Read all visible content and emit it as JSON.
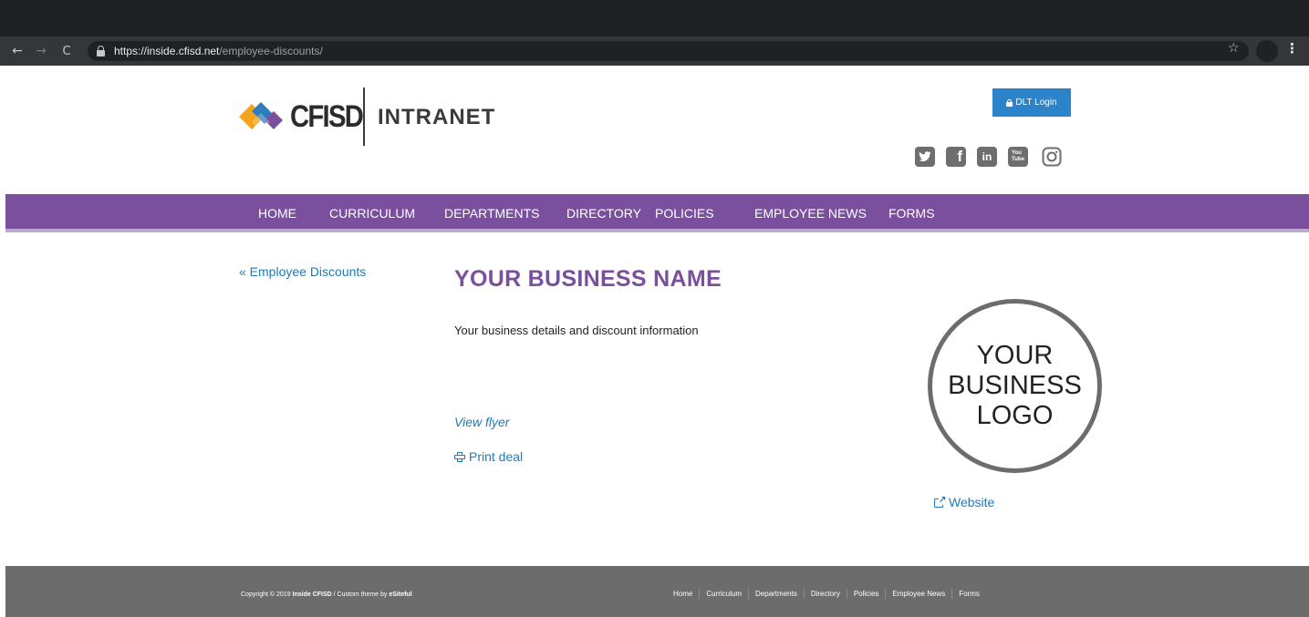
{
  "browser": {
    "url_host": "https://inside.cfisd.net",
    "url_path": "/employee-discounts/",
    "icons": {
      "back": "←",
      "forward": "→",
      "reload": "C",
      "star": "☆",
      "menu": "⋮"
    }
  },
  "header": {
    "logo_text": "CFISD",
    "logo_sub": "INTRANET",
    "logo_colors": {
      "orange": "#f2a41c",
      "blue": "#2d7dbf",
      "purple": "#7a4f9e"
    },
    "login_label": "DLT Login",
    "social": [
      {
        "name": "twitter-icon",
        "glyph": "t"
      },
      {
        "name": "facebook-icon",
        "glyph": "f"
      },
      {
        "name": "linkedin-icon",
        "glyph": "in"
      },
      {
        "name": "youtube-icon",
        "glyph": "You Tube"
      },
      {
        "name": "instagram-icon",
        "glyph": ""
      }
    ]
  },
  "nav": {
    "items": [
      "HOME",
      "CURRICULUM",
      "DEPARTMENTS",
      "DIRECTORY",
      "POLICIES",
      "EMPLOYEE NEWS",
      "FORMS"
    ],
    "color": "#7a4f9e"
  },
  "content": {
    "back_link": "« Employee Discounts",
    "title": "YOUR BUSINESS NAME",
    "details": "Your business details and discount information",
    "view_flyer": "View flyer",
    "print_deal": "Print deal",
    "logo_placeholder": [
      "YOUR",
      "BUSINESS",
      "LOGO"
    ],
    "website": "Website"
  },
  "footer": {
    "copyright_prefix": "Copyright © 2019 ",
    "site_name": "Inside CFISD",
    "theme_text": " / Custom theme by ",
    "theme_author": "eSiteful",
    "links": [
      "Home",
      "Curriculum",
      "Departments",
      "Directory",
      "Policies",
      "Employee News",
      "Forms"
    ]
  }
}
